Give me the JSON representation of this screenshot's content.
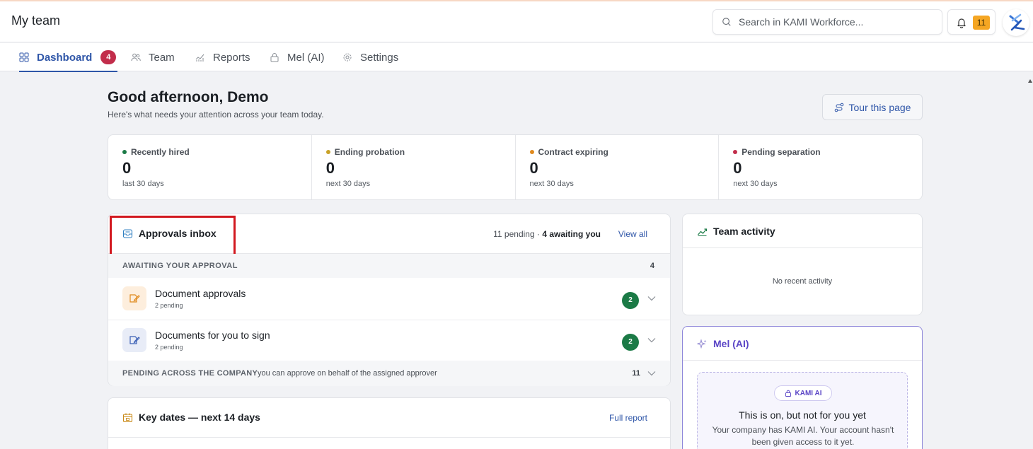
{
  "header": {
    "title": "My team",
    "search_placeholder": "Search in KAMI Workforce...",
    "notification_count": "11"
  },
  "nav": {
    "tabs": [
      {
        "label": "Dashboard",
        "badge": "4",
        "active": true
      },
      {
        "label": "Team"
      },
      {
        "label": "Reports"
      },
      {
        "label": "Mel (AI)"
      },
      {
        "label": "Settings"
      }
    ]
  },
  "page": {
    "greeting": "Good afternoon, Demo",
    "subtitle": "Here's what needs your attention across your team today.",
    "tour_button": "Tour this page"
  },
  "stats": [
    {
      "label": "Recently hired",
      "value": "0",
      "sub": "last 30 days",
      "color": "#1b7a46"
    },
    {
      "label": "Ending probation",
      "value": "0",
      "sub": "next 30 days",
      "color": "#c9a227"
    },
    {
      "label": "Contract expiring",
      "value": "0",
      "sub": "next 30 days",
      "color": "#e08a1e"
    },
    {
      "label": "Pending separation",
      "value": "0",
      "sub": "next 30 days",
      "color": "#c22d4b"
    }
  ],
  "approvals": {
    "title": "Approvals inbox",
    "summary_pending": "11 pending · ",
    "summary_awaiting": "4 awaiting you",
    "view_all": "View all",
    "awaiting_label": "AWAITING YOUR APPROVAL",
    "awaiting_count": "4",
    "items": [
      {
        "title": "Document approvals",
        "sub": "2 pending",
        "count": "2"
      },
      {
        "title": "Documents for you to sign",
        "sub": "2 pending",
        "count": "2"
      }
    ],
    "company_label": "PENDING ACROSS THE COMPANY",
    "company_note": "you can approve on behalf of the assigned approver",
    "company_count": "11"
  },
  "key_dates": {
    "title": "Key dates — next 14 days",
    "link": "Full report"
  },
  "activity": {
    "title": "Team activity",
    "empty": "No recent activity"
  },
  "mel": {
    "title": "Mel (AI)",
    "pill": "KAMI AI",
    "heading": "This is on, but not for you yet",
    "body": "Your company has KAMI AI. Your account hasn't been given access to it yet."
  },
  "colors": {
    "accent": "#2f56a8",
    "badge_red": "#c22d4b",
    "success_green": "#1b7a46",
    "notification_orange": "#f5a623",
    "ai_purple": "#5b46c6",
    "highlight_red": "#d2181f"
  }
}
